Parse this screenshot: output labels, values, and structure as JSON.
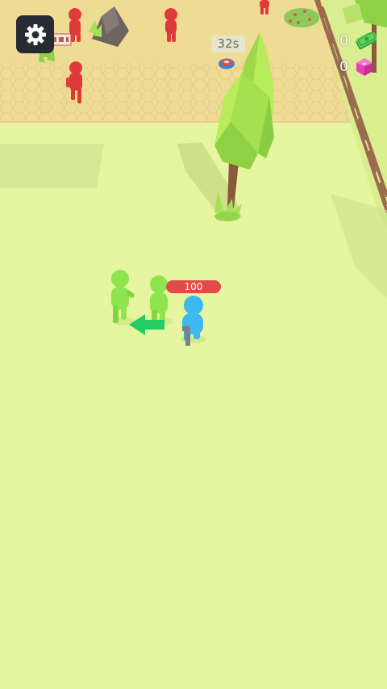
{
  "hud": {
    "timer_text": "32s",
    "cash_count": "0",
    "gem_count": "0",
    "player_health": "100"
  },
  "icons": {
    "settings": "gear-icon",
    "cash": "cash-icon",
    "gem": "gem-icon",
    "timer": "timer-icon"
  },
  "colors": {
    "ground": "#e6f5a0",
    "enemy_zone": "#eedc94",
    "enemy": "#e0393a",
    "ally": "#8ee44c",
    "player": "#3fb8f0",
    "health_bar": "#e04b48",
    "direction_arrow": "#22cc66"
  }
}
